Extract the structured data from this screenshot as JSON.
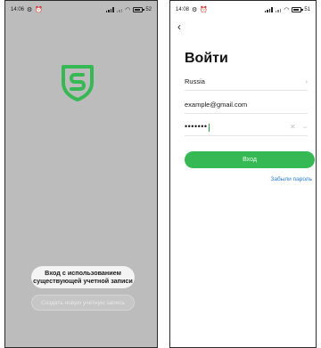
{
  "left_screen": {
    "status": {
      "time": "14:06",
      "battery": "52"
    },
    "login_existing_label": "Вход с использованием существующей учетной записи",
    "create_account_label": "Создать новую учетную запись",
    "colors": {
      "background": "#bcbcbc",
      "logo": "#36b855"
    }
  },
  "right_screen": {
    "status": {
      "time": "14:08",
      "battery": "51"
    },
    "back_icon": "chevron-left-icon",
    "title": "Войти",
    "country": "Russia",
    "email": "example@gmail.com",
    "password_masked": "•••••••",
    "submit_label": "Вход",
    "forgot_password_label": "Забыли пароль",
    "colors": {
      "accent": "#36b855",
      "link": "#2a7bd6"
    }
  }
}
